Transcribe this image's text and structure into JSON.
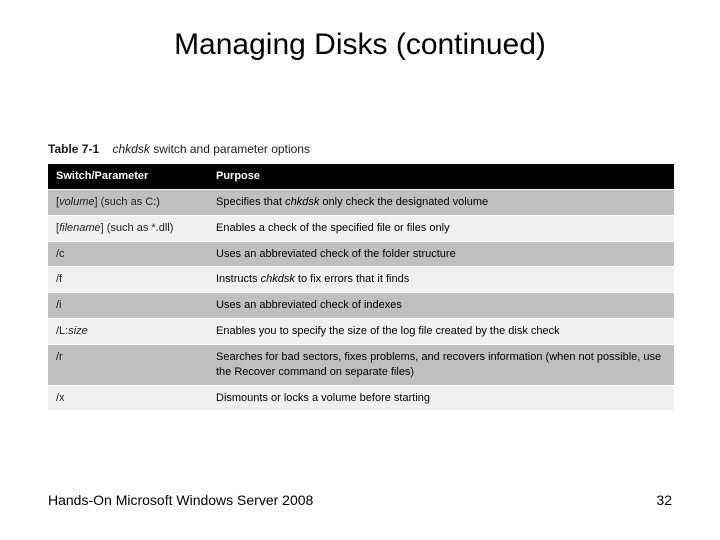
{
  "slide": {
    "title": "Managing Disks (continued)",
    "footer_left": "Hands-On Microsoft Windows Server 2008",
    "page_number": "32"
  },
  "table": {
    "caption_bold": "Table 7-1",
    "caption_ital": "chkdsk",
    "caption_rest": " switch and parameter options",
    "headers": {
      "switch": "Switch/Parameter",
      "purpose": "Purpose"
    },
    "rows": [
      {
        "switch_pre": "[",
        "switch_ital": "volume",
        "switch_post": "] (such as C:)",
        "purpose_pre": "Specifies that ",
        "purpose_ital": "chkdsk",
        "purpose_post": " only check the designated volume"
      },
      {
        "switch_pre": "[",
        "switch_ital": "filename",
        "switch_post": "] (such as *.dll)",
        "purpose_pre": "Enables a check of the specified file or files only",
        "purpose_ital": "",
        "purpose_post": ""
      },
      {
        "switch_pre": "/c",
        "switch_ital": "",
        "switch_post": "",
        "purpose_pre": "Uses an abbreviated check of the folder structure",
        "purpose_ital": "",
        "purpose_post": ""
      },
      {
        "switch_pre": "/f",
        "switch_ital": "",
        "switch_post": "",
        "purpose_pre": "Instructs ",
        "purpose_ital": "chkdsk",
        "purpose_post": " to fix errors that it finds"
      },
      {
        "switch_pre": "/i",
        "switch_ital": "",
        "switch_post": "",
        "purpose_pre": "Uses an abbreviated check of indexes",
        "purpose_ital": "",
        "purpose_post": ""
      },
      {
        "switch_pre": "/L:",
        "switch_ital": "size",
        "switch_post": "",
        "purpose_pre": "Enables you to specify the size of the log file created by the disk check",
        "purpose_ital": "",
        "purpose_post": ""
      },
      {
        "switch_pre": "/r",
        "switch_ital": "",
        "switch_post": "",
        "purpose_pre": "Searches for bad sectors, fixes problems, and recovers information (when not possible, use the Recover command on separate files)",
        "purpose_ital": "",
        "purpose_post": ""
      },
      {
        "switch_pre": "/x",
        "switch_ital": "",
        "switch_post": "",
        "purpose_pre": "Dismounts or locks a volume before starting",
        "purpose_ital": "",
        "purpose_post": ""
      }
    ]
  }
}
